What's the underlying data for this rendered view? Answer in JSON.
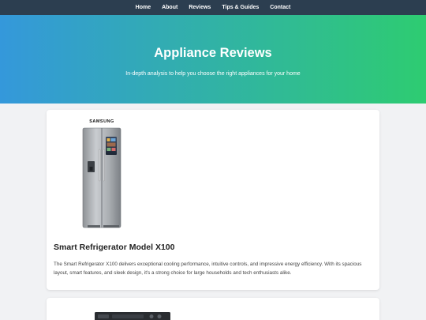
{
  "nav": {
    "items": [
      {
        "label": "Home"
      },
      {
        "label": "About"
      },
      {
        "label": "Reviews"
      },
      {
        "label": "Tips & Guides"
      },
      {
        "label": "Contact"
      }
    ]
  },
  "hero": {
    "title": "Appliance Reviews",
    "subtitle": "In-depth analysis to help you choose the right appliances for your home"
  },
  "reviews": [
    {
      "brand": "SAMSUNG",
      "title": "Smart Refrigerator Model X100",
      "description": "The Smart Refrigerator X100 delivers exceptional cooling performance, intuitive controls, and impressive energy efficiency. With its spacious layout, smart features, and sleek design, it's a strong choice for large households and tech enthusiasts alike."
    }
  ],
  "colors": {
    "nav_bg": "#2c3e50",
    "hero_gradient_start": "#3498db",
    "hero_gradient_end": "#2ecc71"
  }
}
